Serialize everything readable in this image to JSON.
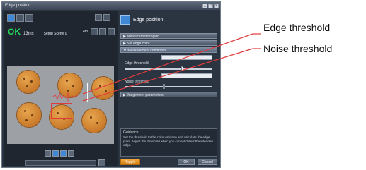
{
  "window": {
    "title": "Edge position"
  },
  "header": {
    "judgement": "OK",
    "time": "13ms",
    "scene": "Setup Scene 0",
    "zoom_label": "4th"
  },
  "right_panel": {
    "title": "Edge position",
    "sections": [
      {
        "label": "▶ Measurement region"
      },
      {
        "label": "▶ Set edge color"
      },
      {
        "label": "▼ Measurement conditions"
      },
      {
        "label": "▶ Judgement parameters"
      }
    ],
    "conditions": {
      "edge_threshold_label": "Edge threshold",
      "noise_threshold_label": "Noise threshold"
    },
    "guidance": {
      "title": "Guidance",
      "text": "Set the threshold to the color variation and calculate the edge point. Adjust the threshold when you cannot detect the intended edge."
    },
    "buttons": {
      "toggle": "Toggle",
      "ok": "OK",
      "cancel": "Cancel"
    }
  },
  "callouts": {
    "edge_threshold": "Edge threshold",
    "noise_threshold": "Noise threshold"
  },
  "colors": {
    "ok_green": "#25d35a",
    "accent_blue": "#3f88d6",
    "callout_red": "#e23b3b",
    "button_orange": "#e8921f"
  },
  "icons": [
    "window-minimize-icon",
    "window-maximize-icon",
    "window-close-icon",
    "camera-icon",
    "image-icon",
    "folder-icon",
    "zoom-in-icon",
    "zoom-out-icon",
    "fit-icon",
    "play-icon",
    "pause-icon",
    "step-icon"
  ]
}
